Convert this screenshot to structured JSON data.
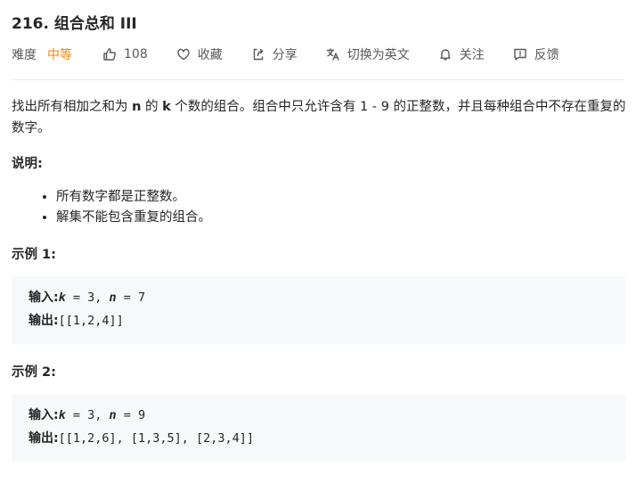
{
  "problem": {
    "title": "216. 组合总和 III",
    "difficulty_label": "难度",
    "difficulty_value": "中等",
    "likes": "108",
    "favorite_label": "收藏",
    "share_label": "分享",
    "switch_lang_label": "切换为英文",
    "follow_label": "关注",
    "feedback_label": "反馈"
  },
  "description": {
    "part1": "找出所有相加之和为 ",
    "var_n": "n",
    "part2": " 的 ",
    "var_k": "k",
    "part3": " 个数的组合。组合中只允许含有 1 - 9 的正整数，并且每种组合中不存在重复的数字。"
  },
  "notes": {
    "heading": "说明:",
    "items": [
      "所有数字都是正整数。",
      "解集不能包含重复的组合。"
    ]
  },
  "examples": [
    {
      "heading": "示例 1:",
      "input_label": "输入:",
      "k_name": "k",
      "k_text": " = 3, ",
      "n_name": "n",
      "n_text": " = 7",
      "output_label": "输出:",
      "output_value": "[[1,2,4]]"
    },
    {
      "heading": "示例 2:",
      "input_label": "输入:",
      "k_name": "k",
      "k_text": " = 3, ",
      "n_name": "n",
      "n_text": " = 9",
      "output_label": "输出:",
      "output_value": "[[1,2,6], [1,3,5], [2,3,4]]"
    }
  ],
  "colors": {
    "difficulty_medium": "#f0840c",
    "code_background": "#f7f8fa",
    "icon_gray": "#595959"
  },
  "icons": [
    "thumbs-up-icon",
    "heart-icon",
    "share-icon",
    "translate-icon",
    "bell-icon",
    "feedback-icon"
  ]
}
